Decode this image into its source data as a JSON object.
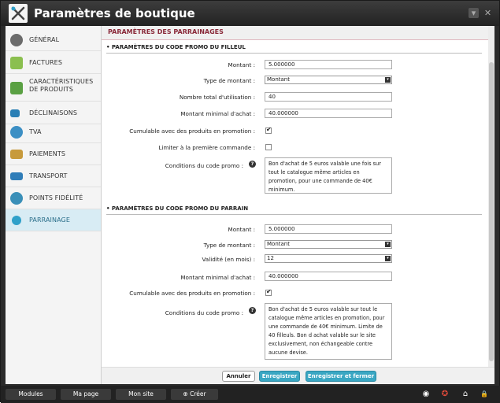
{
  "window": {
    "title": "Paramètres de boutique",
    "minimize_glyph": "▾",
    "close_glyph": "✕"
  },
  "sidebar": {
    "items": [
      {
        "label": "GÉNÉRAL",
        "icon": "gears-icon",
        "color": "#6b6b6b"
      },
      {
        "label": "FACTURES",
        "icon": "invoice-icon",
        "color": "#8bbf4f"
      },
      {
        "label": "CARACTÉRISTIQUES\nDE PRODUITS",
        "icon": "product-features-icon",
        "color": "#5aa043"
      },
      {
        "label": "DÉCLINAISONS",
        "icon": "variations-icon",
        "color": "#2a7fb5"
      },
      {
        "label": "TVA",
        "icon": "globe-icon",
        "color": "#3c8fc4"
      },
      {
        "label": "PAIEMENTS",
        "icon": "payments-icon",
        "color": "#c79a3c"
      },
      {
        "label": "TRANSPORT",
        "icon": "truck-icon",
        "color": "#2f7db8"
      },
      {
        "label": "POINTS FIDÉLITÉ",
        "icon": "heart-badge-icon",
        "color": "#3a8fb8"
      },
      {
        "label": "PARRAINAGE",
        "icon": "network-icon",
        "color": "#2fa0c9"
      }
    ]
  },
  "content": {
    "header": "PARAMÈTRES DES PARRAINAGES",
    "filleul": {
      "title": "• PARAMÈTRES DU CODE PROMO DU FILLEUL",
      "montant_label": "Montant :",
      "montant_value": "5.000000",
      "type_label": "Type de montant :",
      "type_value": "Montant",
      "total_label": "Nombre total d'utilisation :",
      "total_value": "40",
      "min_label": "Montant minimal d'achat :",
      "min_value": "40.000000",
      "cumul_label": "Cumulable avec des produits en promotion :",
      "limit_label": "Limiter à la première commande :",
      "cond_label": "Conditions du code promo :",
      "cond_value": "Bon d'achat de 5 euros valable une fois sur tout le catalogue même articles en promotion, pour une commande de 40€ minimum."
    },
    "parrain": {
      "title": "• PARAMÈTRES DU CODE PROMO DU PARRAIN",
      "montant_label": "Montant :",
      "montant_value": "5.000000",
      "type_label": "Type de montant :",
      "type_value": "Montant",
      "validity_label": "Validité (en mois) :",
      "validity_value": "12",
      "min_label": "Montant minimal d'achat :",
      "min_value": "40.000000",
      "cumul_label": "Cumulable avec des produits en promotion :",
      "cond_label": "Conditions du code promo :",
      "cond_value": "Bon d'achat de 5 euros valable sur tout le catalogue même articles en promotion, pour une commande de 40€ minimum. Limite de 40 filleuls. Bon d achat valable sur le site exclusivement, non échangeable contre aucune devise."
    },
    "help_glyph": "?",
    "select_arrow": "▾"
  },
  "footer": {
    "cancel": "Annuler",
    "save": "Enregistrer",
    "save_close": "Enregistrer et fermer"
  },
  "taskbar": {
    "modules": "Modules",
    "mypage": "Ma page",
    "mysite": "Mon site",
    "create": "Créer",
    "create_glyph": "⊕",
    "eye_glyph": "◉",
    "help_glyph": "✪",
    "home_glyph": "⌂",
    "lock_glyph": "🔒"
  },
  "colors": {
    "accent": "#3aa7c3",
    "header_text": "#8a2a3a"
  }
}
